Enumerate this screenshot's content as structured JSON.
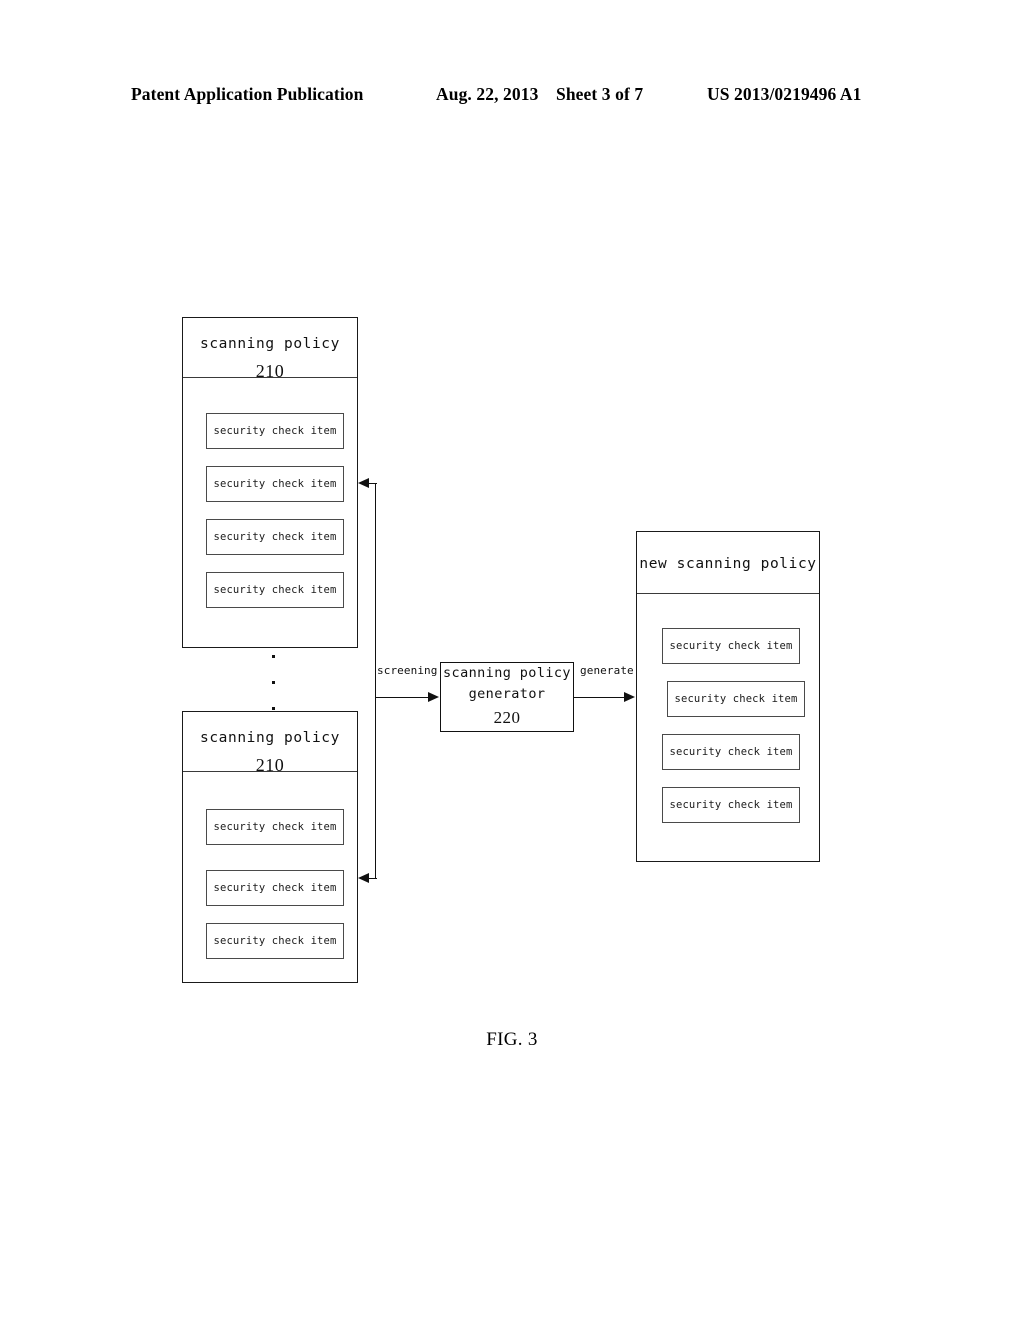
{
  "header": {
    "publication": "Patent Application Publication",
    "date": "Aug. 22, 2013",
    "sheet": "Sheet 3 of 7",
    "patent_number": "US 2013/0219496 A1"
  },
  "figure": {
    "caption": "FIG. 3",
    "item_label": "security check item",
    "nodes": {
      "policy_top": {
        "title": "scanning policy",
        "ref": "210",
        "items": [
          "security check item",
          "security check item",
          "security check item",
          "security check item"
        ]
      },
      "policy_bottom": {
        "title": "scanning policy",
        "ref": "210",
        "items": [
          "security check item",
          "security check item",
          "security check item"
        ]
      },
      "generator": {
        "title_line1": "scanning policy",
        "title_line2": "generator",
        "ref": "220"
      },
      "new_policy": {
        "title": "new scanning policy",
        "ref": "",
        "items": [
          "security check item",
          "security check item",
          "security check item",
          "security check item"
        ]
      }
    },
    "edges": {
      "screening_label": "screening",
      "generate_label": "generate"
    },
    "ellipsis_dots": 3
  }
}
